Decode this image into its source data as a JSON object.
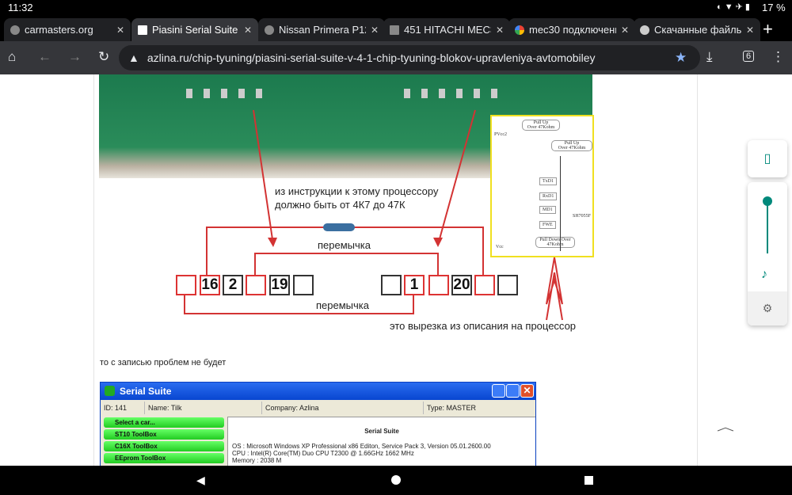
{
  "status": {
    "time": "11:32",
    "battery": "17 %"
  },
  "tabs": [
    {
      "label": "carmasters.org",
      "active": false
    },
    {
      "label": "Piasini Serial Suite",
      "active": true
    },
    {
      "label": "Nissan Primera P12",
      "active": false
    },
    {
      "label": "451 HITACHI MEC3",
      "active": false
    },
    {
      "label": "mec30 подключени",
      "active": false
    },
    {
      "label": "Скачанные файлы",
      "active": false
    }
  ],
  "toolbar": {
    "url": "azlina.ru/chip-tyuning/piasini-serial-suite-v-4-1-chip-tyuning-blokov-upravleniya-avtomobiley",
    "tab_count": "6"
  },
  "diagram": {
    "note1": "из инструкции к этому процессору",
    "note2": "должно быть  от 4К7 до 47К",
    "jumper_top": "перемычка",
    "jumper_bottom": "перемычка",
    "cutout_note": "это вырезка из  описания на процессор",
    "pins": [
      "",
      "16",
      "2",
      "",
      "19",
      "",
      "",
      "1",
      "",
      "20",
      "",
      ""
    ],
    "schematic": {
      "pullup1": "Pull Up\nOver 47Kohm",
      "pullup2": "Pull Up\nOver 47Kohm",
      "pulldown": "Pull Down Over 47Kohm",
      "pins": [
        "TxD1",
        "RxD1",
        "MD1",
        "FWE"
      ],
      "vcc": "Vcc",
      "pvcc": "PVcc2",
      "chip": "SH7055F"
    }
  },
  "body_text": "то с записью проблем не будет",
  "serial_suite": {
    "title": "Serial Suite",
    "id": "ID: 141",
    "name": "Name: Tilk",
    "company": "Company: Azlina",
    "type": "Type: MASTER",
    "menu": [
      "Select a car...",
      "ST10 ToolBox",
      "C16X ToolBox",
      "EEprom ToolBox"
    ],
    "heading": "Serial Suite",
    "os": "OS : Microsoft Windows XP Professional x86 Editon, Service Pack 3, Version 05.01.2600.00",
    "cpu": "CPU : Intel(R) Core(TM) Duo CPU      T2300  @ 1.66GHz 1662 MHz",
    "memory": "Memory : 2038 M"
  },
  "volume": {
    "level": 1.0
  },
  "colors": {
    "accent": "#00897b",
    "red": "#d33333",
    "star": "#8ab4f8"
  }
}
